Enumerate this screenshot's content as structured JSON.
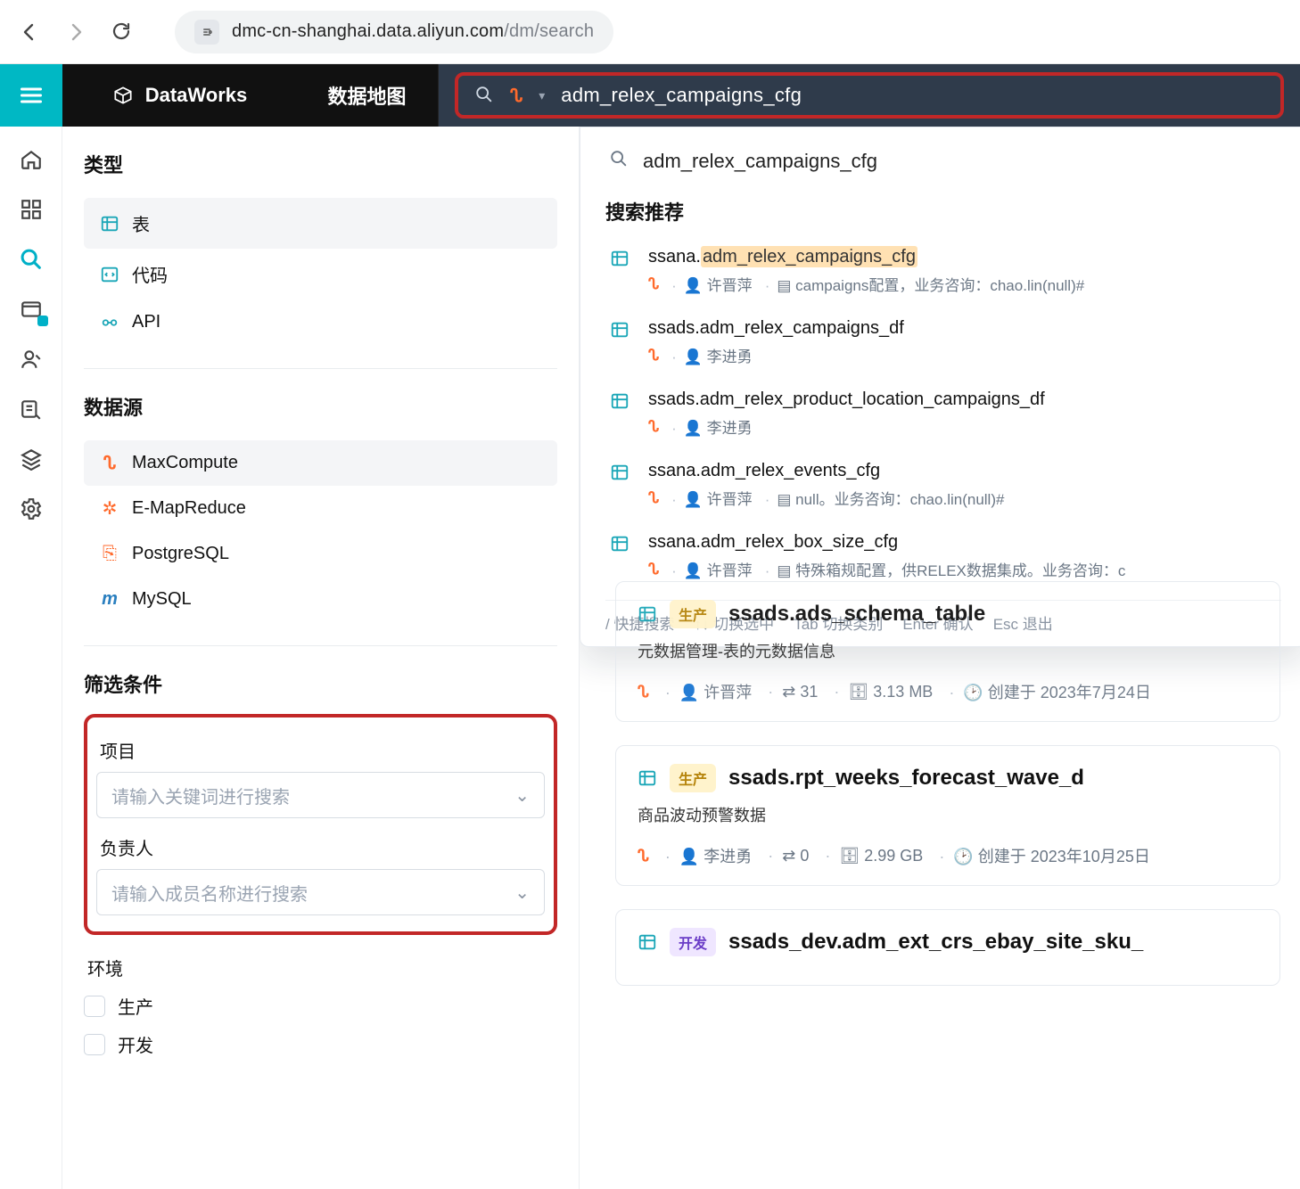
{
  "browser": {
    "url_host": "dmc-cn-shanghai.data.aliyun.com",
    "url_path": "/dm/search"
  },
  "brand": "DataWorks",
  "nav_tab": "数据地图",
  "search": {
    "value": "adm_relex_campaigns_cfg"
  },
  "rail": [
    "home",
    "grid",
    "search",
    "card",
    "user",
    "list",
    "layers",
    "settings"
  ],
  "sidebar": {
    "type_title": "类型",
    "types": [
      {
        "icon": "table",
        "label": "表",
        "active": true
      },
      {
        "icon": "code",
        "label": "代码"
      },
      {
        "icon": "api",
        "label": "API"
      }
    ],
    "ds_title": "数据源",
    "datasources": [
      {
        "icon": "maxcompute",
        "label": "MaxCompute",
        "active": true
      },
      {
        "icon": "emr",
        "label": "E-MapReduce"
      },
      {
        "icon": "postgres",
        "label": "PostgreSQL"
      },
      {
        "icon": "mysql",
        "label": "MySQL"
      }
    ],
    "filter_title": "筛选条件",
    "project_label": "项目",
    "project_placeholder": "请输入关键词进行搜索",
    "owner_label": "负责人",
    "owner_placeholder": "请输入成员名称进行搜索",
    "env_label": "环境",
    "env_options": [
      "生产",
      "开发"
    ]
  },
  "dropdown": {
    "echo": "adm_relex_campaigns_cfg",
    "section_title": "搜索推荐",
    "items": [
      {
        "title_prefix": "ssana.",
        "title_hl": "adm_relex_campaigns_cfg",
        "owner": "许晋萍",
        "desc": "campaigns配置，业务咨询：chao.lin(null)#"
      },
      {
        "title_prefix": "ssads.adm_relex_campaigns_df",
        "owner": "李进勇"
      },
      {
        "title_prefix": "ssads.adm_relex_product_location_campaigns_df",
        "owner": "李进勇"
      },
      {
        "title_prefix": "ssana.adm_relex_events_cfg",
        "owner": "许晋萍",
        "desc": "null。业务咨询：chao.lin(null)#"
      },
      {
        "title_prefix": "ssana.adm_relex_box_size_cfg",
        "owner": "许晋萍",
        "desc": "特殊箱规配置，供RELEX数据集成。业务咨询：c"
      }
    ],
    "hints": {
      "a": "/ 快捷搜索",
      "b": "↑↓ 切换选中",
      "c": "Tab 切换类别",
      "d": "Enter 确认",
      "e": "Esc 退出"
    }
  },
  "results": [
    {
      "env": "生产",
      "env_class": "prod",
      "title": "ssads.ads_schema_table",
      "sub": "元数据管理-表的元数据信息",
      "owner": "许晋萍",
      "count": "31",
      "size": "3.13 MB",
      "created": "创建于 2023年7月24日"
    },
    {
      "env": "生产",
      "env_class": "prod",
      "title": "ssads.rpt_weeks_forecast_wave_d",
      "sub": "商品波动预警数据",
      "owner": "李进勇",
      "count": "0",
      "size": "2.99 GB",
      "created": "创建于 2023年10月25日"
    },
    {
      "env": "开发",
      "env_class": "dev",
      "title": "ssads_dev.adm_ext_crs_ebay_site_sku_"
    }
  ]
}
